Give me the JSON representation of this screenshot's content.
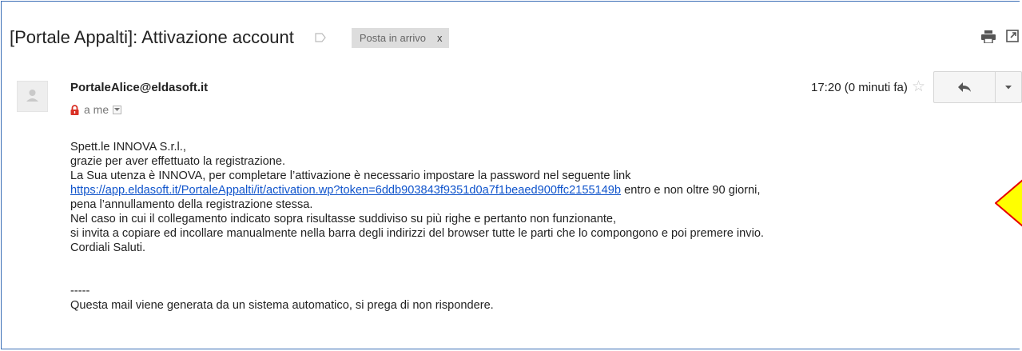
{
  "email": {
    "subject": "[Portale Appalti]: Attivazione account",
    "label_tag": "Posta in arrivo",
    "label_remove": "x",
    "sender": "PortaleAlice@eldasoft.it",
    "recipient": "a me",
    "time": "17:20 (0 minuti fa)"
  },
  "message": {
    "line1": "Spett.le INNOVA S.r.l.,",
    "line2": "grazie per aver effettuato la registrazione.",
    "line3": "La Sua utenza è INNOVA, per completare l’attivazione è necessario impostare la password nel seguente link",
    "link": "https://app.eldasoft.it/PortaleAppalti/it/activation.wp?token=6ddb903843f9351d0a7f1beaed900ffc2155149b",
    "line4_suffix": " entro e non oltre 90 giorni,",
    "line5": "pena l’annullamento della registrazione stessa.",
    "line6": "Nel caso in cui il collegamento indicato sopra risultasse suddiviso su più righe e pertanto non funzionante,",
    "line7": "si invita a copiare ed incollare manualmente nella barra degli indirizzi del browser tutte le parti che lo compongono e poi premere invio.",
    "line8": "Cordiali Saluti.",
    "separator": "-----",
    "footer": "Questa mail viene generata da un sistema automatico, si prega di non rispondere."
  },
  "icons": {
    "label": "label-icon",
    "print": "print-icon",
    "popout": "popout-icon",
    "avatar": "avatar-icon",
    "lock": "lock-icon",
    "star": "star-icon",
    "reply": "reply-icon",
    "more": "chevron-down-icon",
    "annotation": "arrow-left-icon"
  },
  "colors": {
    "link": "#1155cc",
    "frame": "#3b6fb6",
    "arrow_fill": "#ffff00",
    "arrow_stroke": "#e60000",
    "lock": "#d93025"
  }
}
